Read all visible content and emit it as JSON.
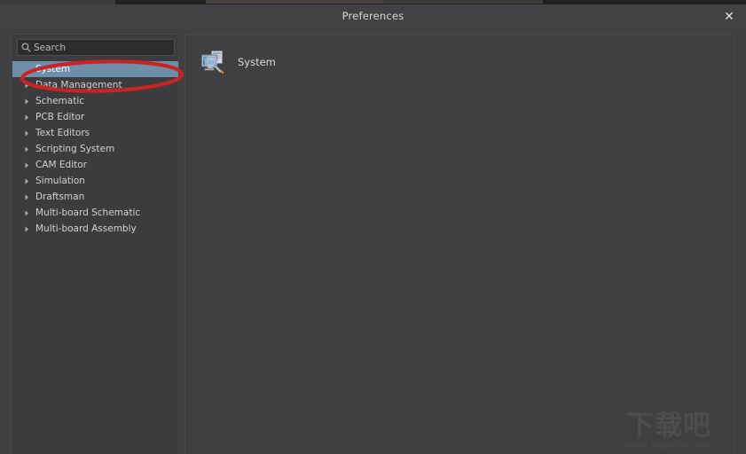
{
  "window": {
    "title": "Preferences",
    "close_label": "✕"
  },
  "sidebar": {
    "search": {
      "placeholder": "Search",
      "icon": "search-icon"
    },
    "items": [
      {
        "label": "System",
        "expandable": false,
        "selected": true
      },
      {
        "label": "Data Management",
        "expandable": true,
        "selected": false
      },
      {
        "label": "Schematic",
        "expandable": true,
        "selected": false
      },
      {
        "label": "PCB Editor",
        "expandable": true,
        "selected": false
      },
      {
        "label": "Text Editors",
        "expandable": true,
        "selected": false
      },
      {
        "label": "Scripting System",
        "expandable": true,
        "selected": false
      },
      {
        "label": "CAM Editor",
        "expandable": true,
        "selected": false
      },
      {
        "label": "Simulation",
        "expandable": true,
        "selected": false
      },
      {
        "label": "Draftsman",
        "expandable": true,
        "selected": false
      },
      {
        "label": "Multi-board Schematic",
        "expandable": true,
        "selected": false
      },
      {
        "label": "Multi-board Assembly",
        "expandable": true,
        "selected": false
      }
    ]
  },
  "main": {
    "entry": {
      "label": "System",
      "icon": "system-monitor-magnifier-icon"
    }
  },
  "annotation": {
    "type": "ellipse",
    "color": "#cc2222",
    "target": "System"
  },
  "watermark": {
    "logo": "下载吧",
    "url": "www.xiazaiba.com"
  },
  "colors": {
    "window_background": "#403f42",
    "titlebar": "#424143",
    "panel_border": "#4a494c",
    "selection": "#6d8fac",
    "text": "#d2d2d4",
    "annotation_red": "#cc2222"
  }
}
